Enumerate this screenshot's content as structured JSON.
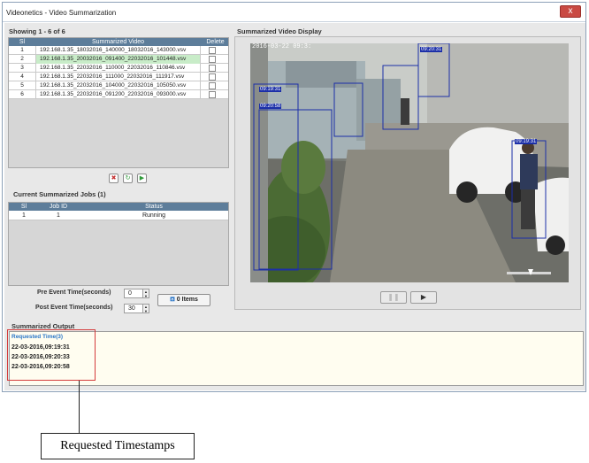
{
  "window": {
    "title": "Videonetics - Video Summarization",
    "close": "x"
  },
  "videos": {
    "section_title": "Showing 1 - 6 of 6",
    "columns": [
      "Sl",
      "Summarized Video",
      "Delete"
    ],
    "rows": [
      {
        "sl": "1",
        "name": "192.168.1.35_18032016_140000_18032016_143000.vsv"
      },
      {
        "sl": "2",
        "name": "192.168.1.35_20032016_091400_22032016_101448.vsv"
      },
      {
        "sl": "3",
        "name": "192.168.1.35_22032016_110000_22032016_110846.vsv"
      },
      {
        "sl": "4",
        "name": "192.168.1.35_22032016_111000_22032016_111917.vsv"
      },
      {
        "sl": "5",
        "name": "192.168.1.35_22032016_104000_22032016_105050.vsv"
      },
      {
        "sl": "6",
        "name": "192.168.1.35_22032016_091200_22032016_093000.vsv"
      }
    ],
    "action_icons": [
      "delete-icon",
      "refresh-icon",
      "play-icon"
    ]
  },
  "jobs": {
    "section_title": "Current Summarized Jobs (1)",
    "columns": [
      "Sl",
      "Job ID",
      "Status"
    ],
    "rows": [
      {
        "sl": "1",
        "job_id": "1",
        "status": "Running"
      }
    ]
  },
  "settings": {
    "pre_label": "Pre Event Time(seconds)",
    "pre_value": "0",
    "post_label": "Post Event Time(seconds)",
    "post_value": "30",
    "items_button": "0 Items"
  },
  "display": {
    "section_title": "Summarized Video Display",
    "timestamp_overlay": "2016-03-22 09:3:",
    "tags": [
      "09:20:31",
      "09:19:31",
      "09:20:58",
      "09:19:31"
    ],
    "pause_icon": "pause-icon",
    "play_icon": "play-icon"
  },
  "output": {
    "section_title": "Summarized Output",
    "header": "Requested Time(3)",
    "lines": [
      "22-03-2016,09:19:31",
      "22-03-2016,09:20:33",
      "22-03-2016,09:20:58"
    ]
  },
  "annotation": {
    "label": "Requested Timestamps"
  },
  "colors": {
    "table_header": "#5d7d9a",
    "row_highlight": "#c8ecc8",
    "callout_box": "#d43b3b",
    "output_header": "#2a76c8"
  }
}
